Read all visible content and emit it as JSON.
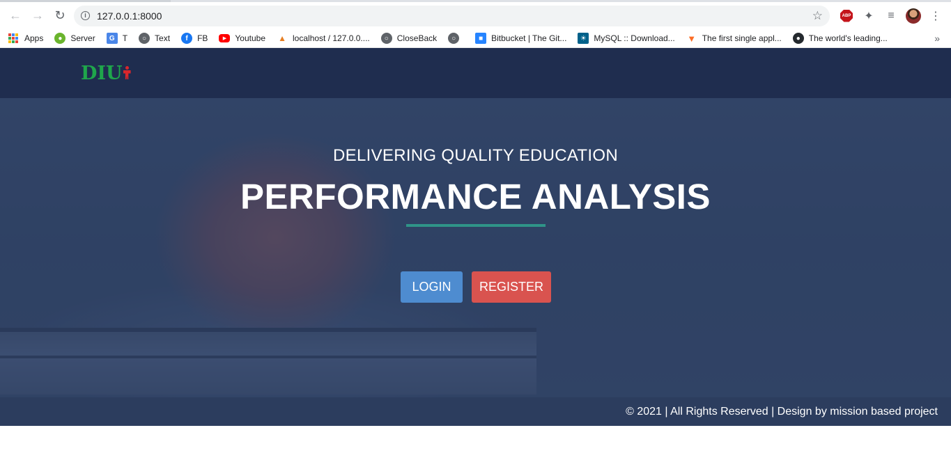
{
  "browser": {
    "url": "127.0.0.1:8000",
    "bookmarks": [
      {
        "label": "Apps",
        "icon": "apps-grid-icon"
      },
      {
        "label": "Server",
        "icon": "server-icon"
      },
      {
        "label": "T",
        "icon": "translate-icon"
      },
      {
        "label": "Text",
        "icon": "globe-icon"
      },
      {
        "label": "FB",
        "icon": "facebook-icon"
      },
      {
        "label": "Youtube",
        "icon": "youtube-icon"
      },
      {
        "label": "localhost / 127.0.0....",
        "icon": "phpmyadmin-icon"
      },
      {
        "label": "CloseBack",
        "icon": "globe-icon"
      },
      {
        "label": "",
        "icon": "globe-icon"
      },
      {
        "label": "Bitbucket | The Git...",
        "icon": "bitbucket-icon"
      },
      {
        "label": "MySQL :: Download...",
        "icon": "mysql-icon"
      },
      {
        "label": "The first single appl...",
        "icon": "gitlab-icon"
      },
      {
        "label": "The world's leading...",
        "icon": "github-icon"
      }
    ]
  },
  "site": {
    "logo_text": "DIU",
    "kicker": "DELIVERING QUALITY EDUCATION",
    "headline": "PERFORMANCE ANALYSIS",
    "login_label": "LOGIN",
    "register_label": "REGISTER",
    "footer": "© 2021 | All Rights Reserved | Design by mission based project"
  },
  "colors": {
    "header_bg": "#1f2d4f",
    "divider": "#2f9488",
    "login_btn": "#4e8cd0",
    "register_btn": "#d9534f",
    "logo_green": "#1fa64b",
    "logo_red": "#d9262b"
  }
}
